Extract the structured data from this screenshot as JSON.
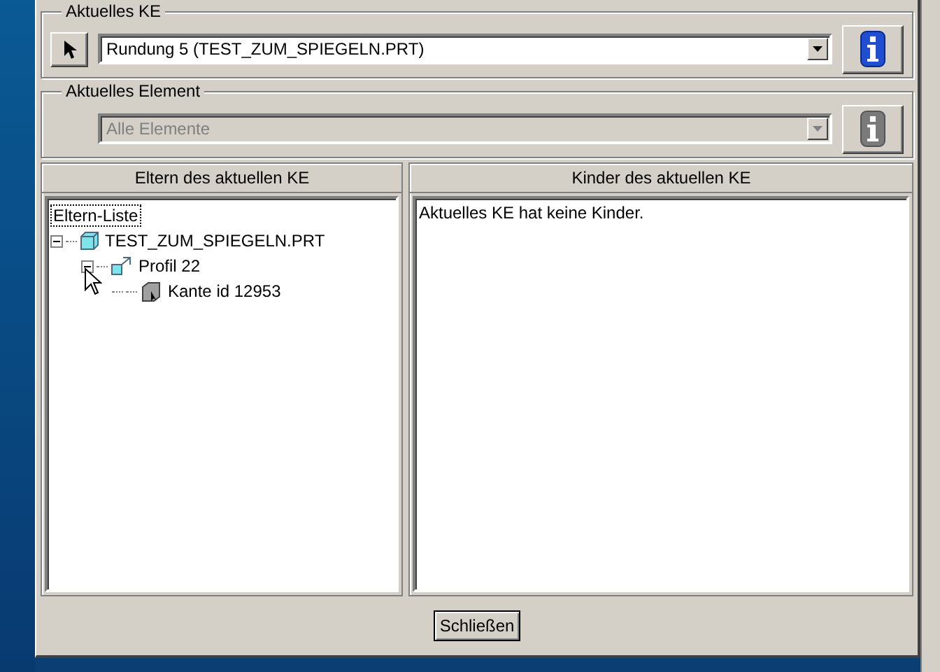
{
  "groups": [
    {
      "title": "Aktuelles KE",
      "value": "Rundung 5 (TEST_ZUM_SPIEGELN.PRT)",
      "disabled": false,
      "has_picker": true
    },
    {
      "title": "Aktuelles Element",
      "value": "Alle Elemente",
      "disabled": true,
      "has_picker": false
    }
  ],
  "panels": [
    {
      "header": "Eltern des aktuellen KE",
      "kind": "tree",
      "root_label": "Eltern-Liste",
      "tree": [
        {
          "label": "TEST_ZUM_SPIEGELN.PRT",
          "kind": "part",
          "expanded": true,
          "children": [
            {
              "label": "Profil 22",
              "kind": "profile",
              "expanded": true,
              "children": [
                {
                  "label": "Kante id 12953",
                  "kind": "edge"
                }
              ]
            }
          ]
        }
      ]
    },
    {
      "header": "Kinder des aktuellen KE",
      "kind": "message",
      "message": "Aktuelles KE hat keine Kinder."
    }
  ],
  "close_button": "Schließen"
}
